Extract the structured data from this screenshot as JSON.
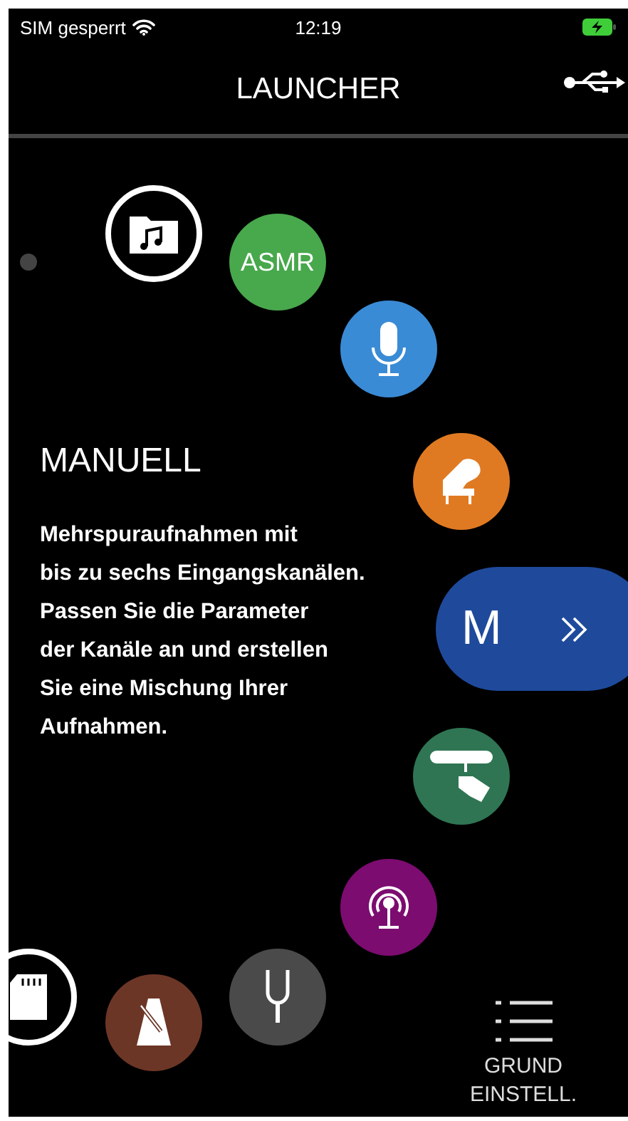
{
  "status_bar": {
    "carrier": "SIM gesperrt",
    "time": "12:19"
  },
  "title": "LAUNCHER",
  "mode": {
    "title": "MANUELL",
    "description": "Mehrspuraufnahmen mit\nbis zu sechs Eingangskanälen.\nPassen Sie die Parameter\nder Kanäle an und erstellen\nSie eine Mischung Ihrer\nAufnahmen."
  },
  "launcher_items": [
    {
      "kind": "folder",
      "color": "#ffffff",
      "selected": false
    },
    {
      "kind": "text",
      "label": "ASMR",
      "color": "#48a84c",
      "selected": false
    },
    {
      "kind": "mic",
      "color": "#3a8bd6",
      "selected": false
    },
    {
      "kind": "piano",
      "color": "#e07a22",
      "selected": false
    },
    {
      "kind": "text",
      "label": "M",
      "color": "#1f4a9c",
      "selected": true
    },
    {
      "kind": "spray",
      "color": "#2f7553",
      "selected": false
    },
    {
      "kind": "antenna",
      "color": "#7c0c70",
      "selected": false
    },
    {
      "kind": "fork",
      "color": "#4a4a4a",
      "selected": false
    },
    {
      "kind": "metronome",
      "color": "#6c3626",
      "selected": false
    },
    {
      "kind": "sdcard",
      "color": "#ffffff",
      "selected": false
    }
  ],
  "settings_button": {
    "label": "GRUND EINSTELL."
  }
}
